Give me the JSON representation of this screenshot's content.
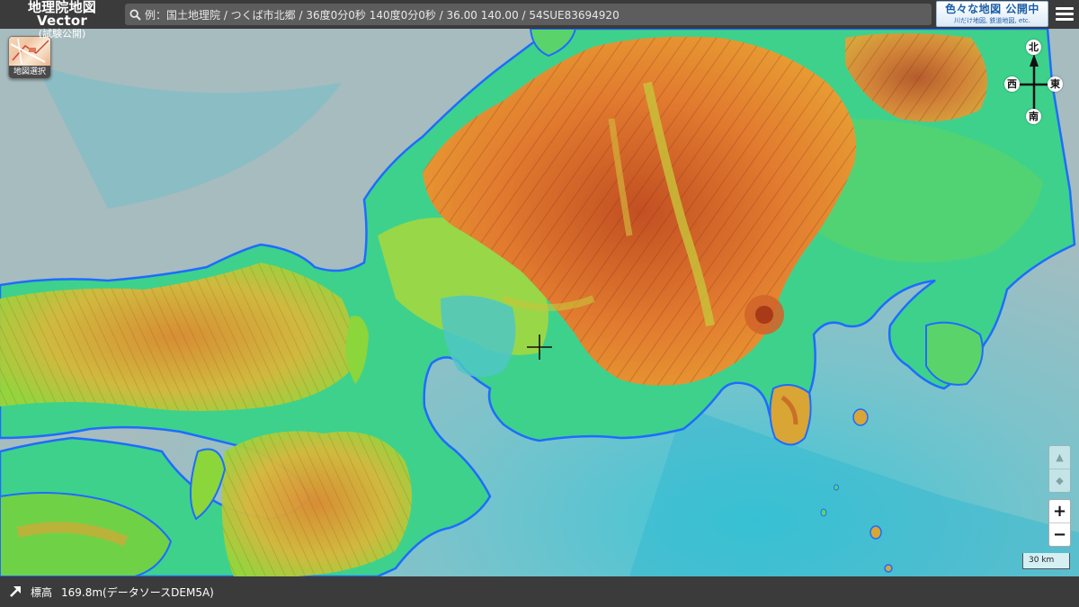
{
  "header": {
    "app_title": "地理院地図Vector",
    "app_subtitle": "(試験公開)",
    "search_placeholder": "例：国土地理院 / つくば市北郷 / 36度0分0秒 140度0分0秒 / 36.00 140.00 / 54SUE83694920",
    "banner_line1": "色々な地図 公開中",
    "banner_line2": "川だけ地図, 鉄道地図, etc."
  },
  "map": {
    "map_select_label": "地図選択",
    "compass": {
      "north": "北",
      "south": "南",
      "east": "東",
      "west": "西"
    },
    "tilt_up_icon": "▲",
    "tilt_reset_icon": "◆",
    "zoom_in_label": "+",
    "zoom_out_label": "−",
    "scale_label": "30 km",
    "colors": {
      "sea": "#9fb9bd",
      "lowland": "#37d38f",
      "plain": "#8bd63a",
      "hills": "#d9c237",
      "mountain": "#e07a2e",
      "high_mountain": "#b9471e",
      "coastline": "#1e6cff"
    }
  },
  "footer": {
    "elevation_label": "標高",
    "elevation_value": "169.8m(データソースDEM5A)"
  }
}
